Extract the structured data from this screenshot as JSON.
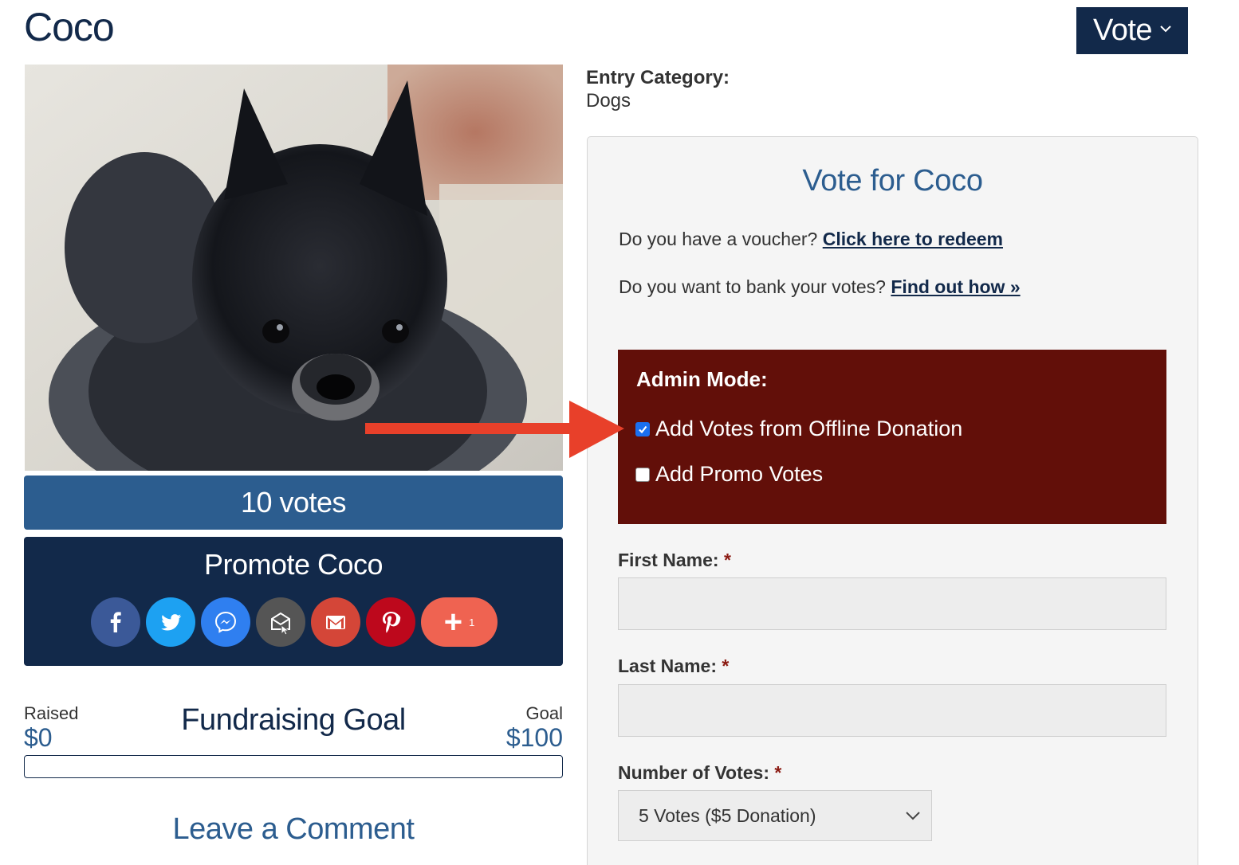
{
  "entry": {
    "title": "Coco"
  },
  "header": {
    "vote_button_label": "Vote"
  },
  "votes": {
    "count_text": "10 votes"
  },
  "promote": {
    "title": "Promote Coco",
    "share_buttons": [
      {
        "icon": "facebook-icon",
        "color": "#3b5998"
      },
      {
        "icon": "twitter-icon",
        "color": "#1da1f2"
      },
      {
        "icon": "messenger-icon",
        "color": "#2f7ff0"
      },
      {
        "icon": "email-icon",
        "color": "#555555"
      },
      {
        "icon": "gmail-icon",
        "color": "#d44638"
      },
      {
        "icon": "pinterest-icon",
        "color": "#bd081c"
      }
    ],
    "more_count": "1"
  },
  "fundraising": {
    "raised_label": "Raised",
    "raised_value": "$0",
    "title": "Fundraising Goal",
    "goal_label": "Goal",
    "goal_value": "$100",
    "progress": 0
  },
  "comments": {
    "title": "Leave a Comment"
  },
  "category": {
    "label": "Entry Category:",
    "value": "Dogs"
  },
  "vote_panel": {
    "title": "Vote for Coco",
    "voucher_question": "Do you have a voucher?",
    "voucher_link": "Click here to redeem",
    "bank_question": "Do you want to bank your votes?",
    "bank_link": "Find out how »"
  },
  "admin": {
    "title": "Admin Mode:",
    "options": [
      {
        "label": "Add Votes from Offline Donation",
        "checked": true
      },
      {
        "label": "Add Promo Votes",
        "checked": false
      }
    ]
  },
  "form": {
    "first_name_label": "First Name:",
    "last_name_label": "Last Name:",
    "num_votes_label": "Number of Votes:",
    "required_mark": "*",
    "num_votes_selected": "5 Votes ($5 Donation)"
  },
  "colors": {
    "navy": "#12294a",
    "blue": "#2c5d8f",
    "admin_bg": "#620f09",
    "arrow": "#e8402a"
  }
}
